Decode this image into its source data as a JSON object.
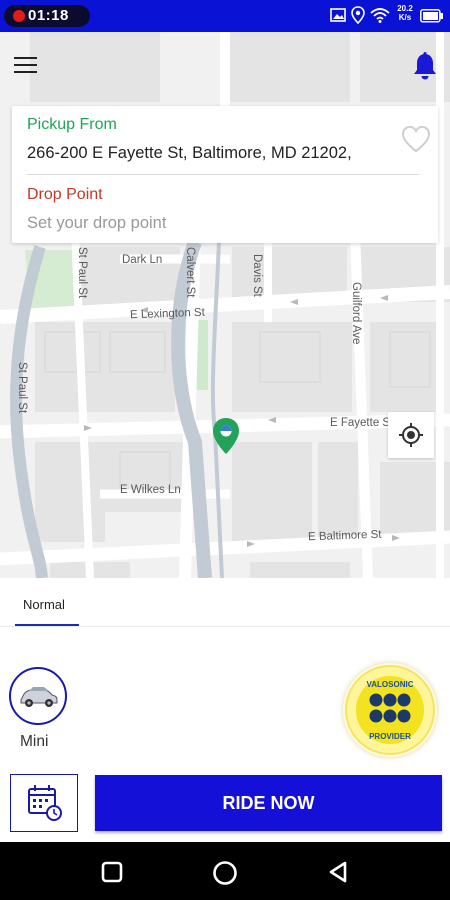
{
  "status_bar": {
    "time": "01:18",
    "net_speed_value": "20.2",
    "net_speed_unit": "K/s",
    "bg_color": "#0a12d6"
  },
  "map": {
    "street_labels": [
      "Dark Ln",
      "E Lexington St",
      "E Fayette St",
      "E Wilkes Ln",
      "E Baltimore St",
      "Calvert St",
      "Davis St",
      "Guilford Ave",
      "St Paul St",
      "St Paul St"
    ],
    "icons": [
      "menu-icon",
      "bell-icon",
      "map-pin-icon",
      "my-location-icon"
    ]
  },
  "address_card": {
    "pickup_label": "Pickup From",
    "pickup_address": "266-200 E Fayette St, Baltimore, MD 21202,",
    "drop_label": "Drop Point",
    "drop_placeholder": "Set your drop point",
    "pickup_color": "#22a358",
    "drop_color": "#c0392b"
  },
  "tabs": [
    {
      "label": "Normal",
      "active": true
    }
  ],
  "vehicles": [
    {
      "label": "Mini",
      "icon": "car-icon"
    }
  ],
  "provider_badge": {
    "top_text": "VALOSONIC",
    "bottom_text": "PROVIDER"
  },
  "actions": {
    "schedule_icon": "calendar-clock-icon",
    "ride_now_label": "RIDE NOW",
    "accent_color": "#1410d8"
  },
  "nav_bar": {
    "icons": [
      "recents-square-icon",
      "home-circle-icon",
      "back-triangle-icon"
    ]
  }
}
